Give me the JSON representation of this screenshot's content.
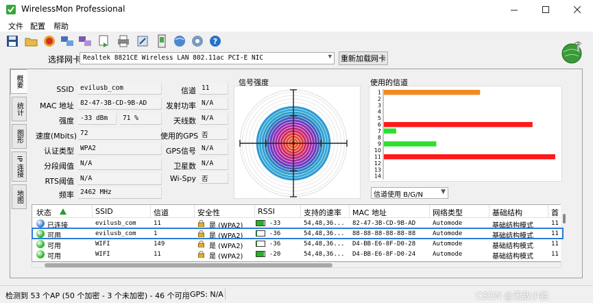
{
  "window": {
    "title": "WirelessMon Professional",
    "minimize_icon": "minimize-icon",
    "maximize_icon": "maximize-icon",
    "close_icon": "close-icon"
  },
  "menu": [
    "文件",
    "配置",
    "帮助"
  ],
  "toolbar_icons": [
    "save-icon",
    "open-folder-icon",
    "record-icon",
    "network-icon",
    "adapter-icon",
    "export-icon",
    "print-icon",
    "gps-icon",
    "log-icon",
    "globe-icon",
    "globe-settings-icon",
    "help-icon"
  ],
  "nic": {
    "label": "选择网卡",
    "selected": "Realtek 8821CE Wireless LAN 802.11ac PCI-E NIC",
    "reload_label": "重新加载网卡"
  },
  "tabs": [
    "概要",
    "统计",
    "图形",
    "IP 连接",
    "地图"
  ],
  "info": {
    "ssid_label": "SSID",
    "ssid": "evilusb_com",
    "mac_label": "MAC 地址",
    "mac": "82-47-3B-CD-9B-AD",
    "strength_label": "强度",
    "strength_dbm": "-33 dBm",
    "strength_pct": "71 %",
    "speed_label": "速度(Mbits)",
    "speed": "72",
    "auth_label": "认证类型",
    "auth": "WPA2",
    "frag_label": "分段阈值",
    "frag": "N/A",
    "rts_label": "RTS阈值",
    "rts": "N/A",
    "freq_label": "频率",
    "freq": "2462 MHz",
    "channel_label": "信道",
    "channel": "11",
    "txpower_label": "发射功率",
    "txpower": "N/A",
    "antenna_label": "天线数",
    "antenna": "N/A",
    "gps_used_label": "使用的GPS",
    "gps_used": "否",
    "gps_signal_label": "GPS信号",
    "gps_signal": "N/A",
    "satellites_label": "卫星数",
    "satellites": "N/A",
    "wispy_label": "Wi-Spy",
    "wispy": "否"
  },
  "signal": {
    "title": "信号强度",
    "strength_fraction": 0.71
  },
  "channels": {
    "title": "使用的信道",
    "labels": [
      "1",
      "2",
      "3",
      "4",
      "5",
      "6",
      "7",
      "8",
      "9",
      "10",
      "11",
      "12",
      "13",
      "14"
    ],
    "bars": [
      {
        "channel": "1",
        "value": 0.55,
        "color": "#f08a24"
      },
      {
        "channel": "6",
        "value": 0.85,
        "color": "#ff1a1a"
      },
      {
        "channel": "7",
        "value": 0.07,
        "color": "#2ee02e"
      },
      {
        "channel": "9",
        "value": 0.3,
        "color": "#2ee02e"
      },
      {
        "channel": "11",
        "value": 0.98,
        "color": "#ff1a1a"
      }
    ],
    "select_value": "信道使用 B/G/N"
  },
  "grid": {
    "headers": [
      "状态",
      "SSID",
      "信道",
      "安全性",
      "RSSI",
      "支持的速率",
      "MAC 地址",
      "网络类型",
      "基础结构",
      "首"
    ],
    "rows": [
      {
        "status": "已连接",
        "status_color": "#3b7fd4",
        "ssid": "evilusb_com",
        "channel": "11",
        "security": "是 (WPA2)",
        "rssi": "-33",
        "rssi_fill": 0.9,
        "rates": "54,48,36...",
        "mac": "82-47-3B-CD-9B-AD",
        "type": "Automode",
        "infra": "基础结构模式",
        "first": "11"
      },
      {
        "status": "可用",
        "status_color": "#2fb82f",
        "ssid": "evilusb_com",
        "channel": "1",
        "security": "是 (WPA2)",
        "rssi": "-36",
        "rssi_fill": 0.1,
        "rates": "54,48,36...",
        "mac": "88-88-88-88-88-88",
        "type": "Automode",
        "infra": "基础结构模式",
        "first": "11"
      },
      {
        "status": "可用",
        "status_color": "#2fb82f",
        "ssid": "WIFI",
        "channel": "149",
        "security": "是 (WPA2)",
        "rssi": "-36",
        "rssi_fill": 0.1,
        "rates": "54,48,36...",
        "mac": "D4-BB-E6-8F-D0-28",
        "type": "Automode",
        "infra": "基础结构模式",
        "first": "11"
      },
      {
        "status": "可用",
        "status_color": "#2fb82f",
        "ssid": "WIFI",
        "channel": "11",
        "security": "是 (WPA2)",
        "rssi": "-20",
        "rssi_fill": 0.9,
        "rates": "54,48,36...",
        "mac": "D4-BB-E6-8F-D0-24",
        "type": "Automode",
        "infra": "基础结构模式",
        "first": "11"
      }
    ]
  },
  "status": {
    "ap_summary": "检测到 53 个AP (50 个加密 - 3 个未加密) - 46 个可用",
    "gps": "GPS: N/A"
  },
  "watermark": "CSDN @无敌小胜"
}
